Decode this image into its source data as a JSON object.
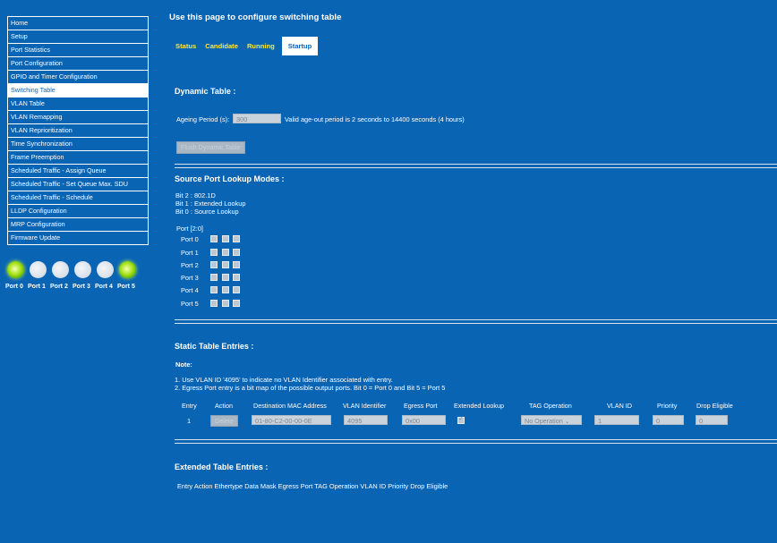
{
  "sidebar": {
    "items": [
      {
        "label": "Home",
        "active": false
      },
      {
        "label": "Setup",
        "active": false
      },
      {
        "label": "Port Statistics",
        "active": false
      },
      {
        "label": "Port Configuration",
        "active": false
      },
      {
        "label": "GPIO and Timer Configuration",
        "active": false
      },
      {
        "label": "Switching Table",
        "active": true
      },
      {
        "label": "VLAN Table",
        "active": false
      },
      {
        "label": "VLAN Remapping",
        "active": false
      },
      {
        "label": "VLAN Reprioritization",
        "active": false
      },
      {
        "label": "Time Synchronization",
        "active": false
      },
      {
        "label": "Frame Preemption",
        "active": false
      },
      {
        "label": "Scheduled Traffic - Assign Queue",
        "active": false
      },
      {
        "label": "Scheduled Traffic - Set Queue Max. SDU",
        "active": false
      },
      {
        "label": "Scheduled Traffic - Schedule",
        "active": false
      },
      {
        "label": "LLDP Configuration",
        "active": false
      },
      {
        "label": "MRP Configuration",
        "active": false
      },
      {
        "label": "Firmware Update",
        "active": false
      }
    ],
    "ports": [
      {
        "label": "Port 0",
        "on": true
      },
      {
        "label": "Port 1",
        "on": false
      },
      {
        "label": "Port 2",
        "on": false
      },
      {
        "label": "Port 3",
        "on": false
      },
      {
        "label": "Port 4",
        "on": false
      },
      {
        "label": "Port 5",
        "on": true
      }
    ]
  },
  "header": {
    "title": "Use this page to configure switching table",
    "tabs": [
      {
        "label": "Status",
        "selected": false
      },
      {
        "label": "Candidate",
        "selected": false
      },
      {
        "label": "Running",
        "selected": false
      },
      {
        "label": "Startup",
        "selected": true
      }
    ]
  },
  "dynamic": {
    "title": "Dynamic Table :",
    "ageing_label": "Ageing Period (s):",
    "ageing_value": "300",
    "ageing_hint": "Valid age-out period is 2 seconds to 14400 seconds (4 hours)",
    "flush_label": "Flush Dynamic Table"
  },
  "source_lookup": {
    "title": "Source Port Lookup Modes :",
    "bits": [
      "Bit 2 : 802.1D",
      "Bit 1 : Extended Lookup",
      "Bit 0 : Source Lookup"
    ],
    "port_header": "Port [2:0]",
    "ports": [
      "Port 0",
      "Port 1",
      "Port 2",
      "Port 3",
      "Port 4",
      "Port 5"
    ]
  },
  "static": {
    "title": "Static Table Entries :",
    "note_label": "Note:",
    "notes": [
      "1. Use VLAN ID '4095' to indicate no VLAN Identifier associated with entry.",
      "2. Egress Port entry is a bit map of the possible output ports. Bit 0 = Port 0 and Bit 5 = Port 5"
    ],
    "columns": [
      "Entry",
      "Action",
      "Destination MAC Address",
      "VLAN Identifier",
      "Egress Port",
      "Extended Lookup",
      "TAG Operation",
      "VLAN ID",
      "Priority",
      "Drop Eligible"
    ],
    "row": {
      "entry": "1",
      "action": "Delete",
      "mac": "01-80-C2-00-00-0E",
      "vlan_identifier": "4095",
      "egress_port": "0x00",
      "extended_lookup": true,
      "tag_operation": "No Operation",
      "vlan_id": "1",
      "priority": "0",
      "drop_eligible": "0"
    }
  },
  "extended": {
    "title": "Extended Table Entries :",
    "columns": [
      "Entry",
      "Action",
      "Ethertype",
      "Data",
      "Mask",
      "Egress Port",
      "TAG Operation",
      "VLAN ID",
      "Priority",
      "Drop Eligible"
    ]
  }
}
